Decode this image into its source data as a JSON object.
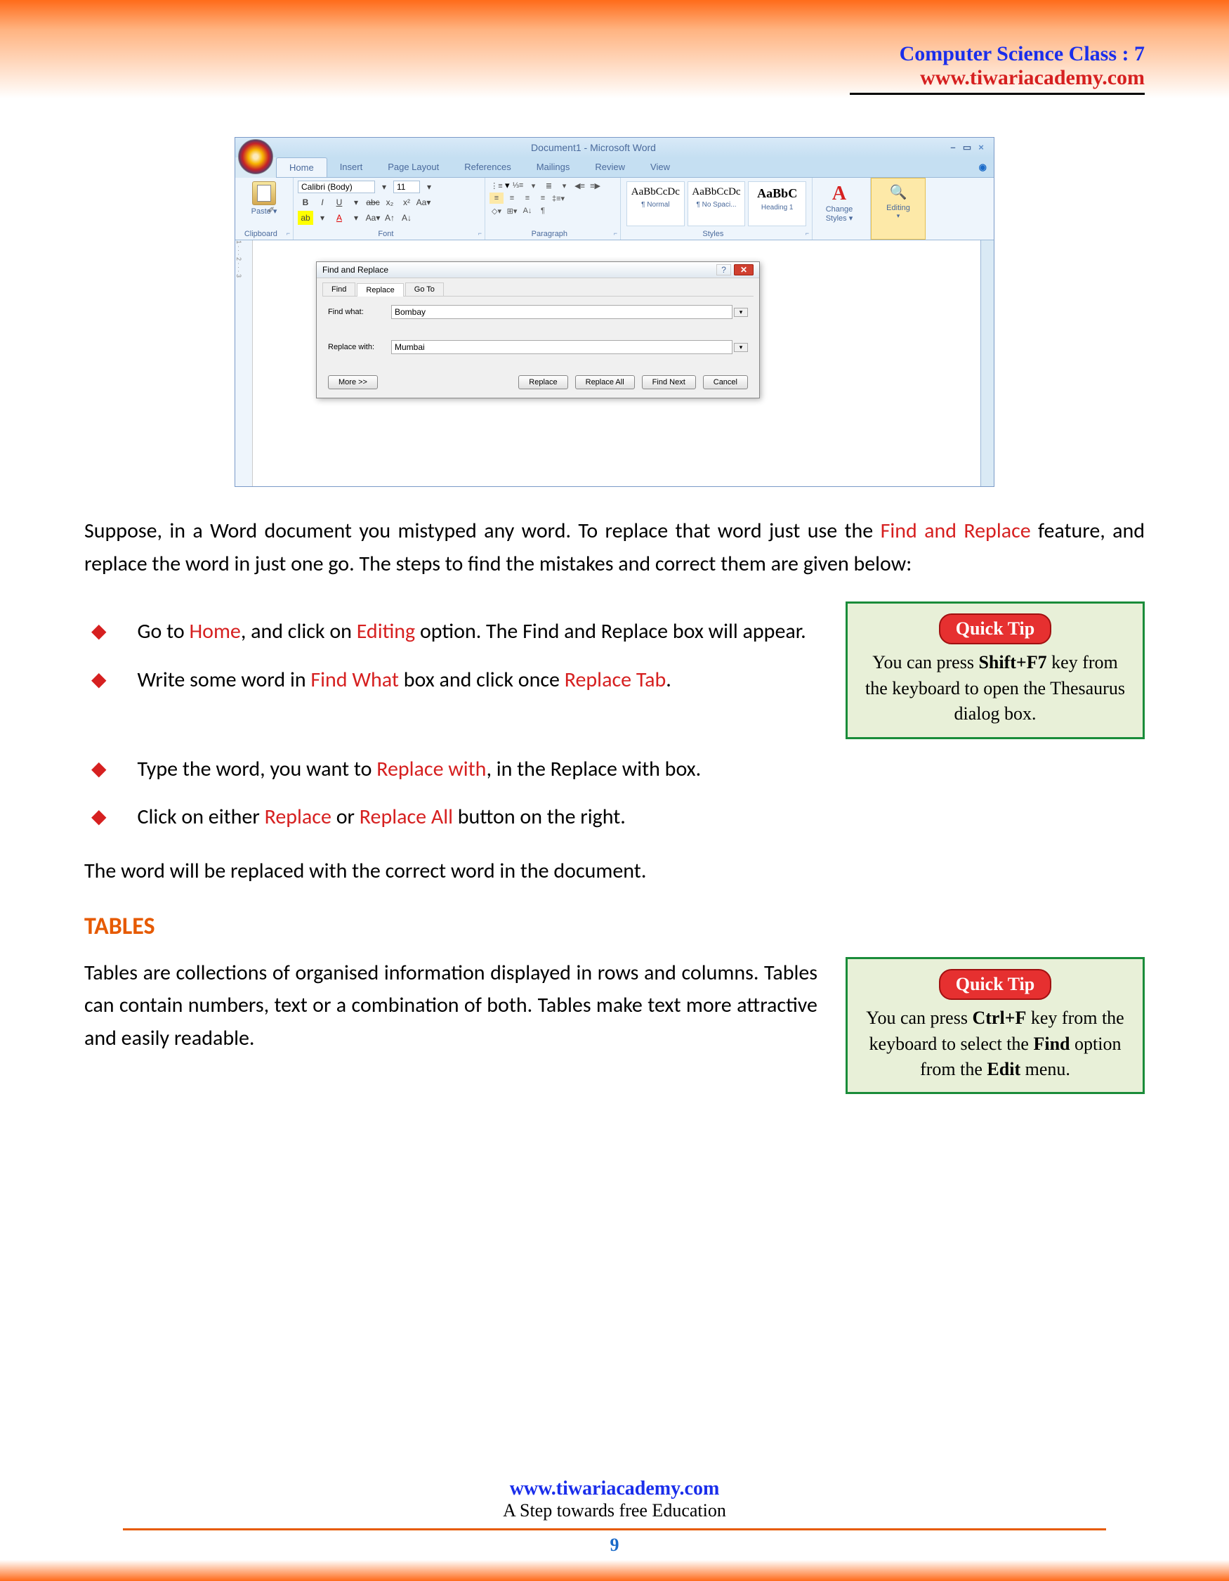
{
  "header": {
    "title": "Computer Science Class : 7",
    "url": "www.tiwariacademy.com"
  },
  "word": {
    "title": "Document1 - Microsoft Word",
    "tabs": [
      "Home",
      "Insert",
      "Page Layout",
      "References",
      "Mailings",
      "Review",
      "View"
    ],
    "clipboard": {
      "label": "Clipboard",
      "paste": "Paste"
    },
    "font": {
      "label": "Font",
      "name": "Calibri (Body)",
      "size": "11"
    },
    "paragraph": {
      "label": "Paragraph"
    },
    "styles": {
      "label": "Styles",
      "items": [
        {
          "preview": "AaBbCcDc",
          "name": "¶ Normal"
        },
        {
          "preview": "AaBbCcDc",
          "name": "¶ No Spaci..."
        },
        {
          "preview": "AaBbC",
          "name": "Heading 1"
        }
      ],
      "change": "Change Styles"
    },
    "editing": {
      "label": "Editing"
    }
  },
  "dialog": {
    "title": "Find and Replace",
    "tabs": [
      "Find",
      "Replace",
      "Go To"
    ],
    "findLabel": "Find what:",
    "findValue": "Bombay",
    "replaceLabel": "Replace with:",
    "replaceValue": "Mumbai",
    "buttons": {
      "more": "More >>",
      "replace": "Replace",
      "replaceAll": "Replace All",
      "findNext": "Find Next",
      "cancel": "Cancel"
    }
  },
  "para1": {
    "p1": "Suppose, in a Word document you mistyped any word. To replace that word just use the ",
    "p2": "Find and Replace",
    "p3": " feature, and replace the word in just one go. The steps to find the mistakes and correct them are given below:"
  },
  "b1": {
    "a": "Go to ",
    "b": "Home",
    "c": ", and click on ",
    "d": "Editing",
    "e": " option. The Find and Replace box will appear."
  },
  "b2": {
    "a": "Write some word in ",
    "b": "Find What",
    "c": " box and click once ",
    "d": "Replace Tab",
    "e": "."
  },
  "b3": {
    "a": "Type the word, you want to ",
    "b": "Replace with",
    "c": ", in the Replace with box."
  },
  "b4": {
    "a": "Click on either ",
    "b": "Replace",
    "c": " or ",
    "d": "Replace All",
    "e": " button on the right."
  },
  "para2": "The word will be replaced with the correct word in the document.",
  "tip1": {
    "title": "Quick Tip",
    "a": "You can press ",
    "b": "Shift+F7",
    "c": " key from the keyboard to open the Thesaurus dialog box."
  },
  "tablesHead": "TABLES",
  "tablesText": "Tables are collections of organised information displayed in rows and columns. Tables can contain numbers, text or a combination of both. Tables make text more attractive and easily readable.",
  "tip2": {
    "title": "Quick Tip",
    "a": "You can press ",
    "b": "Ctrl+F",
    "c": " key from the keyboard to select the ",
    "d": "Find",
    "e": " option from the ",
    "f": "Edit",
    "g": " menu."
  },
  "footer": {
    "url": "www.tiwariacademy.com",
    "tag": "A Step towards free Education",
    "page": "9"
  }
}
